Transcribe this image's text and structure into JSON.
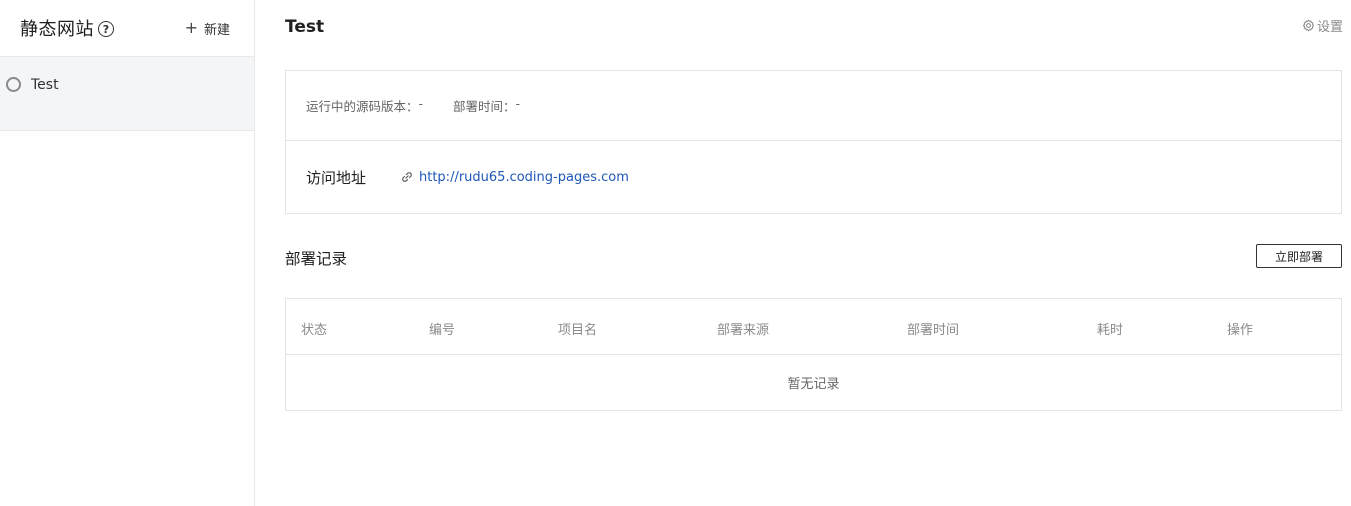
{
  "sidebar": {
    "title": "静态网站",
    "new_label": "新建",
    "items": [
      {
        "name": "Test"
      }
    ]
  },
  "header": {
    "title": "Test",
    "settings_label": "设置"
  },
  "info": {
    "source_version_label": "运行中的源码版本：",
    "source_version_value": "-",
    "deploy_time_label": "部署时间：",
    "deploy_time_value": "-",
    "url_label": "访问地址",
    "url": "http://rudu65.coding-pages.com"
  },
  "records": {
    "title": "部署记录",
    "deploy_now_label": "立即部署",
    "columns": [
      "状态",
      "编号",
      "项目名",
      "部署来源",
      "部署时间",
      "耗时",
      "操作"
    ],
    "empty_text": "暂无记录"
  },
  "colors": {
    "link": "#1f57b8",
    "sidebar_selected_bg": "#f4f5f7",
    "border": "#e3e3e3"
  },
  "icons": [
    "help-icon",
    "plus-icon",
    "status-ring-icon",
    "gear-icon",
    "link-icon"
  ]
}
